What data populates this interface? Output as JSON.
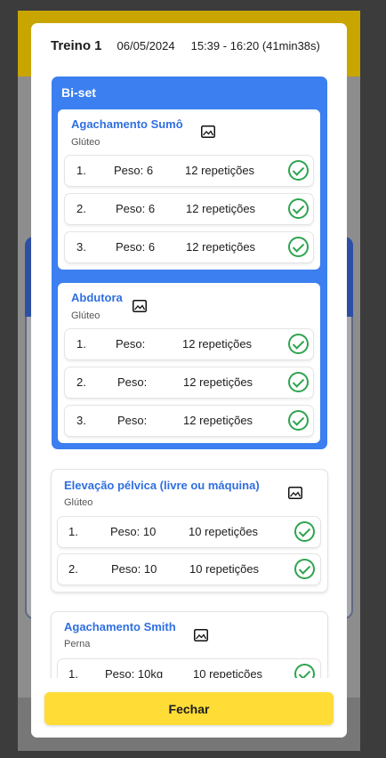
{
  "header": {
    "title": "Treino 1",
    "date": "06/05/2024",
    "time": "15:39 - 16:20 (41min38s)"
  },
  "biset": {
    "label": "Bi-set",
    "exercises": [
      {
        "name": "Agachamento Sumô",
        "group": "Glúteo",
        "sets": [
          {
            "num": "1.",
            "weight": "Peso: 6",
            "reps": "12 repetições",
            "done": true
          },
          {
            "num": "2.",
            "weight": "Peso: 6",
            "reps": "12 repetições",
            "done": true
          },
          {
            "num": "3.",
            "weight": "Peso: 6",
            "reps": "12 repetições",
            "done": true
          }
        ]
      },
      {
        "name": "Abdutora",
        "group": "Glúteo",
        "sets": [
          {
            "num": "1.",
            "weight": "Peso:",
            "reps": "12 repetições",
            "done": true
          },
          {
            "num": "2.",
            "weight": "Peso:",
            "reps": "12 repetições",
            "done": true
          },
          {
            "num": "3.",
            "weight": "Peso:",
            "reps": "12 repetições",
            "done": true
          }
        ]
      }
    ]
  },
  "exercises": [
    {
      "name": "Elevação pélvica (livre ou máquina)",
      "group": "Glúteo",
      "sets": [
        {
          "num": "1.",
          "weight": "Peso: 10",
          "reps": "10 repetições",
          "done": true
        },
        {
          "num": "2.",
          "weight": "Peso: 10",
          "reps": "10 repetições",
          "done": true
        }
      ]
    },
    {
      "name": "Agachamento Smith",
      "group": "Perna",
      "sets": [
        {
          "num": "1.",
          "weight": "Peso: 10kg",
          "reps": "10 repetições",
          "done": true
        }
      ]
    }
  ],
  "footer": {
    "close_label": "Fechar"
  },
  "colors": {
    "accent_blue": "#3b7ff0",
    "check_green": "#2ea44f",
    "button_yellow": "#ffdd36",
    "header_gold": "#c9a500"
  },
  "icons": {
    "exercise_image": "image-icon",
    "set_done": "check-circle-icon"
  }
}
